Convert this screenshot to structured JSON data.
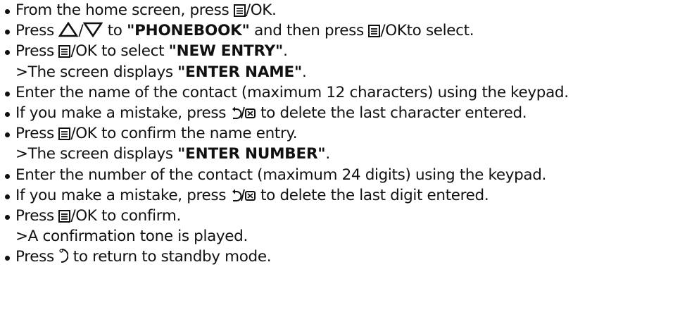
{
  "keys": {
    "ok": "/OK",
    "ok_to": "/OKto",
    "updown_sep": "/"
  },
  "steps": [
    {
      "type": "bullet",
      "text": "From the home screen, press {ok}."
    },
    {
      "type": "bullet",
      "text": "Press {up}/{down} to **\"PHONEBOOK\"** and then press {okto} select."
    },
    {
      "type": "bullet",
      "text": "Press {ok} to select **\"NEW ENTRY\"**."
    },
    {
      "type": "sub",
      "text": ">The screen displays **\"ENTER NAME\"**."
    },
    {
      "type": "bullet",
      "text": "Enter the name of the contact (maximum 12 characters) using the keypad."
    },
    {
      "type": "bullet",
      "text": "If you make a mistake, press {back} to delete the last character entered."
    },
    {
      "type": "bullet",
      "text": "Press {ok} to confirm the name entry."
    },
    {
      "type": "sub",
      "text": ">The screen displays **\"ENTER NUMBER\"**."
    },
    {
      "type": "bullet",
      "text": "Enter the number of the contact (maximum 24 digits) using the keypad."
    },
    {
      "type": "bullet",
      "text": "If you make a mistake, press {back} to delete the last digit entered."
    },
    {
      "type": "bullet",
      "text": "Press {ok} to confirm."
    },
    {
      "type": "sub",
      "text": ">A confirmation tone is played."
    },
    {
      "type": "bullet",
      "text": "Press {end} to return to standby mode."
    }
  ],
  "icons": {
    "menu": "menu-icon",
    "up": "up-triangle-icon",
    "down": "down-triangle-icon",
    "back": "back-delete-icon",
    "end": "end-call-icon"
  }
}
